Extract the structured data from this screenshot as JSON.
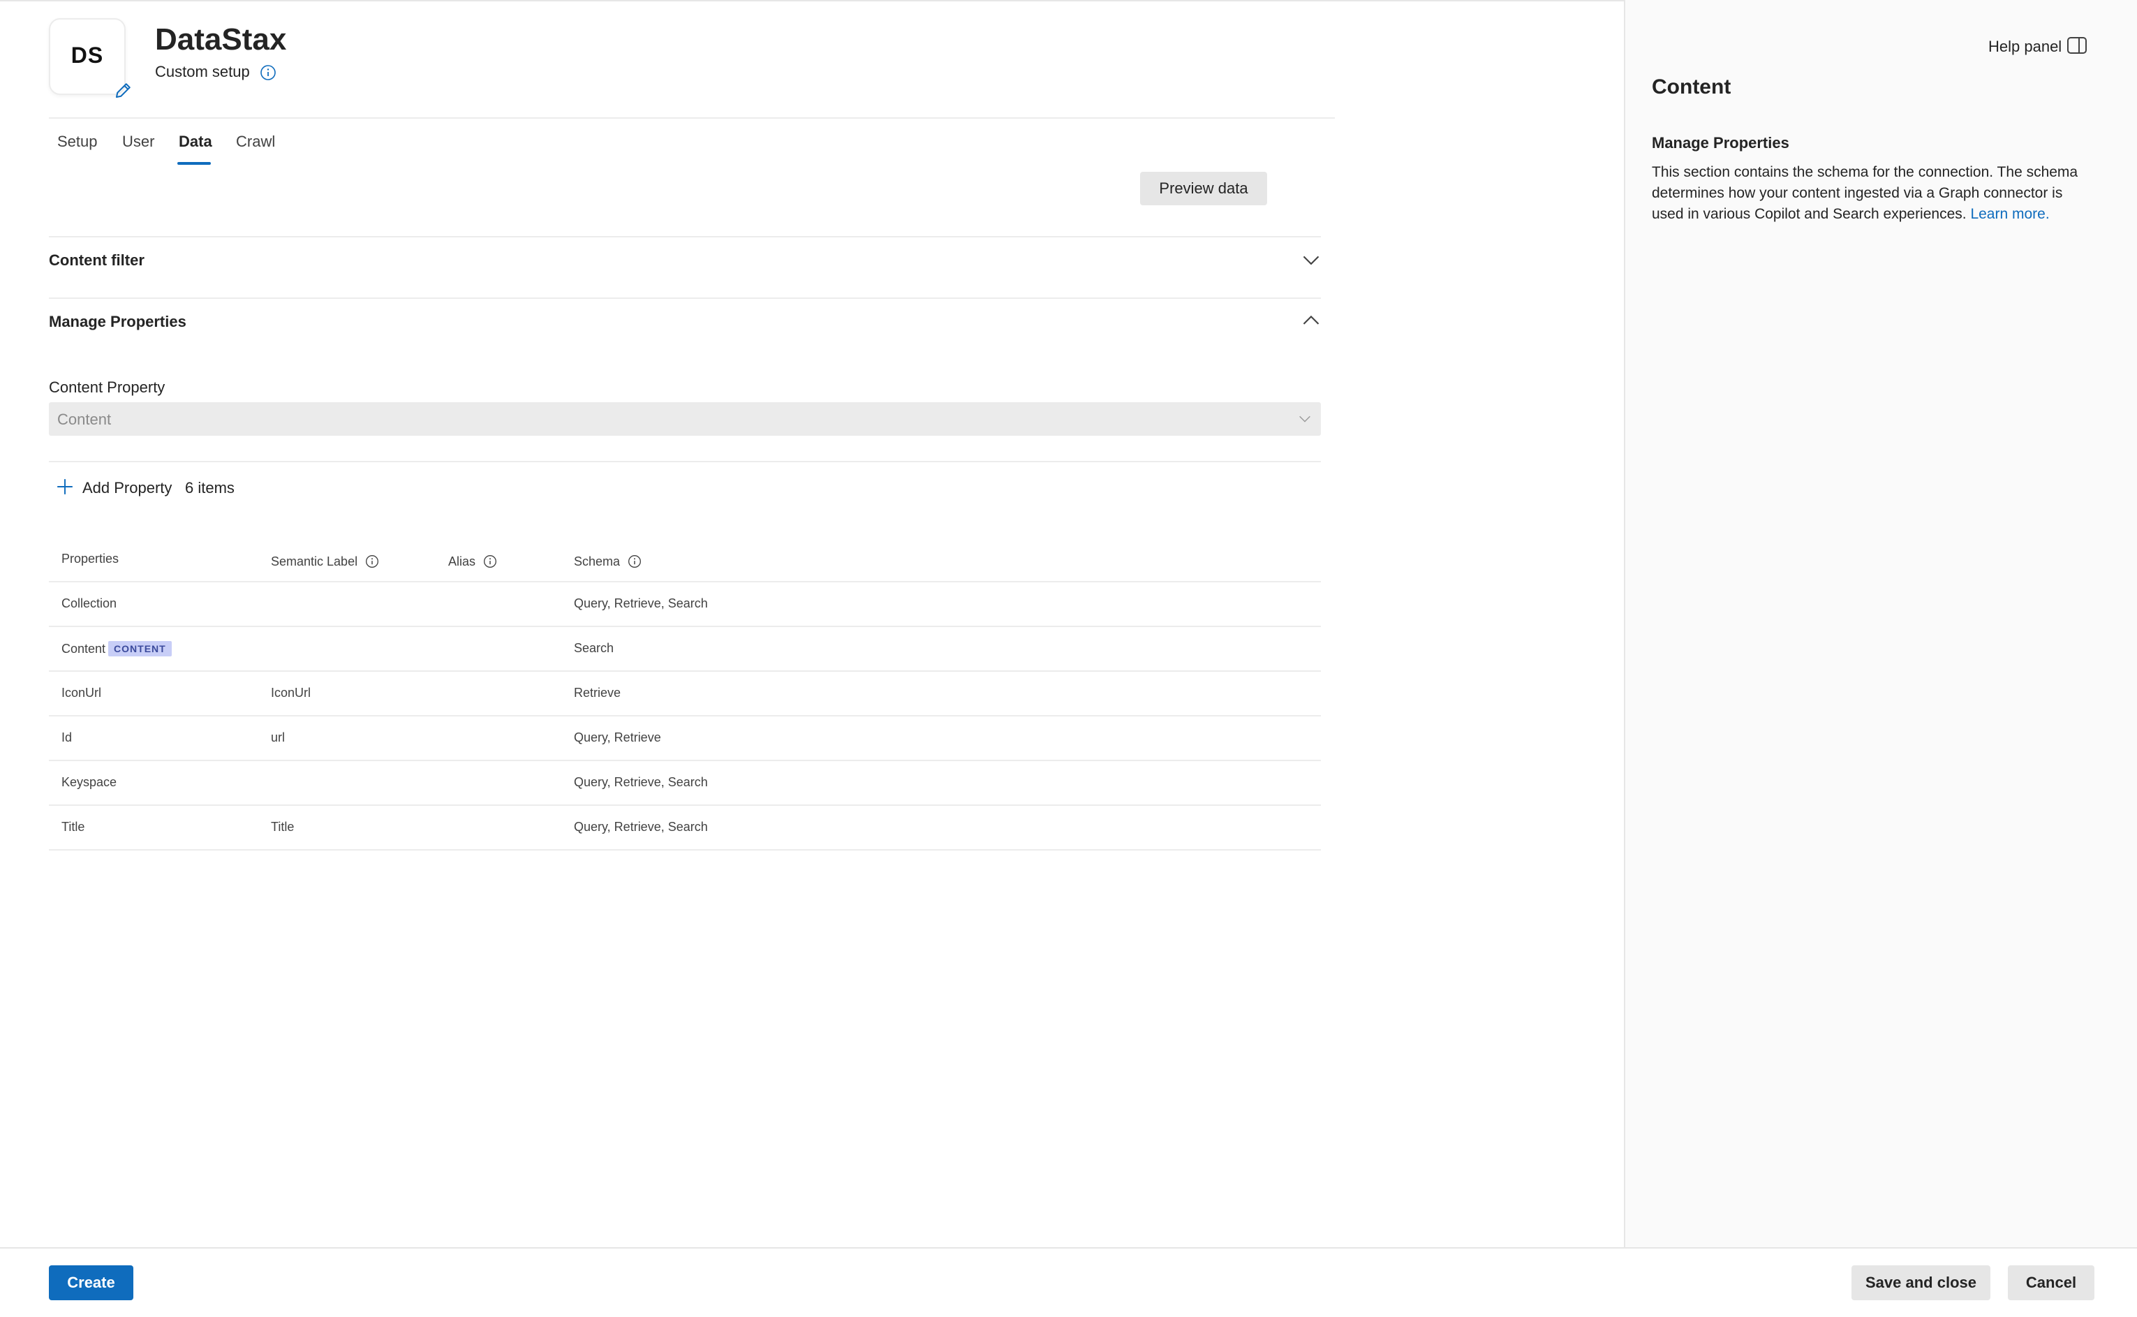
{
  "app": {
    "logo_text": "DS",
    "title": "DataStax",
    "subtitle": "Custom setup"
  },
  "tabs": [
    {
      "label": "Setup",
      "active": false
    },
    {
      "label": "User",
      "active": false
    },
    {
      "label": "Data",
      "active": true
    },
    {
      "label": "Crawl",
      "active": false
    }
  ],
  "preview_button": "Preview data",
  "sections": {
    "content_filter": {
      "title": "Content filter",
      "expanded": false
    },
    "manage_properties": {
      "title": "Manage Properties",
      "expanded": true
    }
  },
  "content_property": {
    "label": "Content Property",
    "value": "Content"
  },
  "toolbar": {
    "add_property_label": "Add Property",
    "items_count": "6 items"
  },
  "table": {
    "headers": {
      "properties": "Properties",
      "semantic_label": "Semantic Label",
      "alias": "Alias",
      "schema": "Schema"
    },
    "rows": [
      {
        "property": "Collection",
        "badge": "",
        "semantic_label": "",
        "alias": "",
        "schema": "Query, Retrieve, Search"
      },
      {
        "property": "Content",
        "badge": "CONTENT",
        "semantic_label": "",
        "alias": "",
        "schema": "Search"
      },
      {
        "property": "IconUrl",
        "badge": "",
        "semantic_label": "IconUrl",
        "alias": "",
        "schema": "Retrieve"
      },
      {
        "property": "Id",
        "badge": "",
        "semantic_label": "url",
        "alias": "",
        "schema": "Query, Retrieve"
      },
      {
        "property": "Keyspace",
        "badge": "",
        "semantic_label": "",
        "alias": "",
        "schema": "Query, Retrieve, Search"
      },
      {
        "property": "Title",
        "badge": "",
        "semantic_label": "Title",
        "alias": "",
        "schema": "Query, Retrieve, Search"
      }
    ]
  },
  "help_panel": {
    "toggle_label": "Help panel",
    "title": "Content",
    "subtitle": "Manage Properties",
    "body": "This section contains the schema for the connection. The schema determines how your content ingested via a Graph connector is used in various Copilot and Search experiences.",
    "link_text": "Learn more."
  },
  "footer": {
    "create_label": "Create",
    "save_close_label": "Save and close",
    "cancel_label": "Cancel"
  },
  "colors": {
    "accent": "#0f6cbd",
    "badge_bg": "#c8cef7",
    "badge_text": "#3b4a9c",
    "divider": "#ececec"
  }
}
